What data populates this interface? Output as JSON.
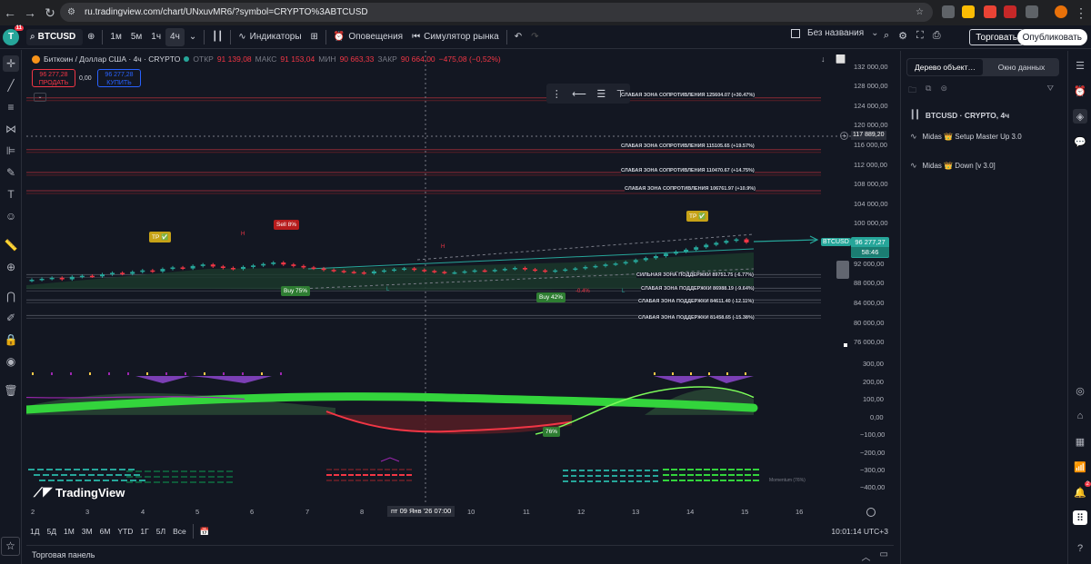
{
  "browser": {
    "url": "ru.tradingview.com/chart/UNxuvMR6/?symbol=CRYPTO%3ABTCUSD"
  },
  "toolbar": {
    "avatar_letter": "T",
    "avatar_badge": "11",
    "symbol": "BTCUSD",
    "intervals": [
      "1м",
      "5м",
      "1ч",
      "4ч"
    ],
    "indicators_label": "Индикаторы",
    "alerts_label": "Оповещения",
    "simulator_label": "Симулятор рынка",
    "layout_name": "Без названия",
    "trade_label": "Торговать",
    "publish_label": "Опубликовать"
  },
  "legend": {
    "title": "Биткоин / Доллар США · 4ч · CRYPTO",
    "open_label": "ОТКР",
    "open_value": "91 139,08",
    "high_label": "МАКС",
    "high_value": "91 153,04",
    "low_label": "МИН",
    "low_value": "90 663,33",
    "close_label": "ЗАКР",
    "close_value": "90 664,00",
    "change": "−475,08 (−0,52%)",
    "sell_price": "96 277,28",
    "sell_label": "ПРОДАТЬ",
    "spread": "0,00",
    "buy_price": "96 277,28",
    "buy_label": "КУПИТЬ"
  },
  "zones": [
    "СЛАБАЯ ЗОНА СОПРОТИВЛЕНИЯ 125604.07 (+30.47%)",
    "СЛАБАЯ ЗОНА СОПРОТИВЛЕНИЯ 115105.65 (+19.57%)",
    "СЛАБАЯ ЗОНА СОПРОТИВЛЕНИЯ 110470.67 (+14.75%)",
    "СЛАБАЯ ЗОНА СОПРОТИВЛЕНИЯ 106761.97 (+10.9%)",
    "СИЛЬНАЯ ЗОНА ПОДДЕРЖКИ 89751.75 (-6.77%)",
    "СЛАБАЯ ЗОНА ПОДДЕРЖКИ 86988.19 (-9.64%)",
    "СЛАБАЯ ЗОНА ПОДДЕРЖКИ 84611.40 (-12.11%)",
    "СЛАБАЯ ЗОНА ПОДДЕРЖКИ 81458.65 (-15.38%)"
  ],
  "signals": {
    "sell": "Sell 8%",
    "buy1": "Buy 75%",
    "buy2": "Buy 42%",
    "tp": "TP ✅",
    "pct": "-0.4%",
    "h": "H",
    "l": "L",
    "osc": "76%"
  },
  "price_scale": {
    "labels": [
      "132 000,00",
      "128 000,00",
      "124 000,00",
      "120 000,00",
      "116 000,00",
      "112 000,00",
      "108 000,00",
      "104 000,00",
      "100 000,00",
      "92 000,00",
      "88 000,00",
      "84 000,00",
      "80 000,00",
      "76 000,00"
    ],
    "osc_labels": [
      "300,00",
      "200,00",
      "100,00",
      "0,00",
      "−100,00",
      "−200,00",
      "−300,00",
      "−400,00"
    ],
    "crosshair_price": "117 889,20",
    "current_price": "96 277,27",
    "countdown": "58:46",
    "symbol_tag": "BTCUSD"
  },
  "time_scale": {
    "labels": [
      "2",
      "3",
      "4",
      "5",
      "6",
      "7",
      "8",
      "10",
      "11",
      "12",
      "13",
      "14",
      "15",
      "16"
    ],
    "cursor": "пт 09 Янв '26   07:00"
  },
  "logo": "TradingView",
  "momentum_labels": [
    "Momentum (76%)"
  ],
  "range_bar": {
    "items": [
      "1Д",
      "5Д",
      "1М",
      "3М",
      "6М",
      "YTD",
      "1Г",
      "5Л",
      "Все"
    ],
    "clock": "10:01:14 UTC+3"
  },
  "bottom_panel": {
    "title": "Торговая панель"
  },
  "right_panel": {
    "tabs": [
      "Дерево объект…",
      "Окно данных"
    ],
    "items": [
      "BTCUSD · CRYPTO, 4ч",
      "Midas 👑 Setup Master Up 3.0",
      "Midas 👑 Down [v 3.0]"
    ]
  },
  "sidebar": {
    "alerts_badge": "2"
  },
  "colors": {
    "background": "#131722",
    "bull": "#26a69a",
    "bear": "#f23645",
    "accent": "#2962ff",
    "osc_green": "#33d43c"
  },
  "chart_data": {
    "type": "candlestick",
    "title": "Биткоин / Доллар США · 4ч · CRYPTO",
    "ylim": [
      74000,
      134000
    ],
    "close_approx": [
      88700,
      88900,
      89100,
      88800,
      89300,
      89500,
      89400,
      89800,
      90100,
      89900,
      90300,
      90600,
      90400,
      90900,
      91200,
      91000,
      91500,
      91800,
      91400,
      91100,
      90900,
      91300,
      91600,
      91900,
      92200,
      91800,
      91500,
      91200,
      91000,
      90700,
      90500,
      90300,
      90200,
      90000,
      90400,
      90600,
      90800,
      91000,
      90700,
      90500,
      90300,
      90100,
      90200,
      90400,
      90600,
      90500,
      90700,
      90900,
      91100,
      90800,
      90600,
      90400,
      90600,
      90800,
      91000,
      91300,
      91500,
      91800,
      92000,
      92300,
      92700,
      93100,
      93500,
      94000,
      94400,
      94800,
      95300,
      95800,
      96200,
      96600,
      96900,
      96277
    ],
    "current_price": 96277.27
  }
}
